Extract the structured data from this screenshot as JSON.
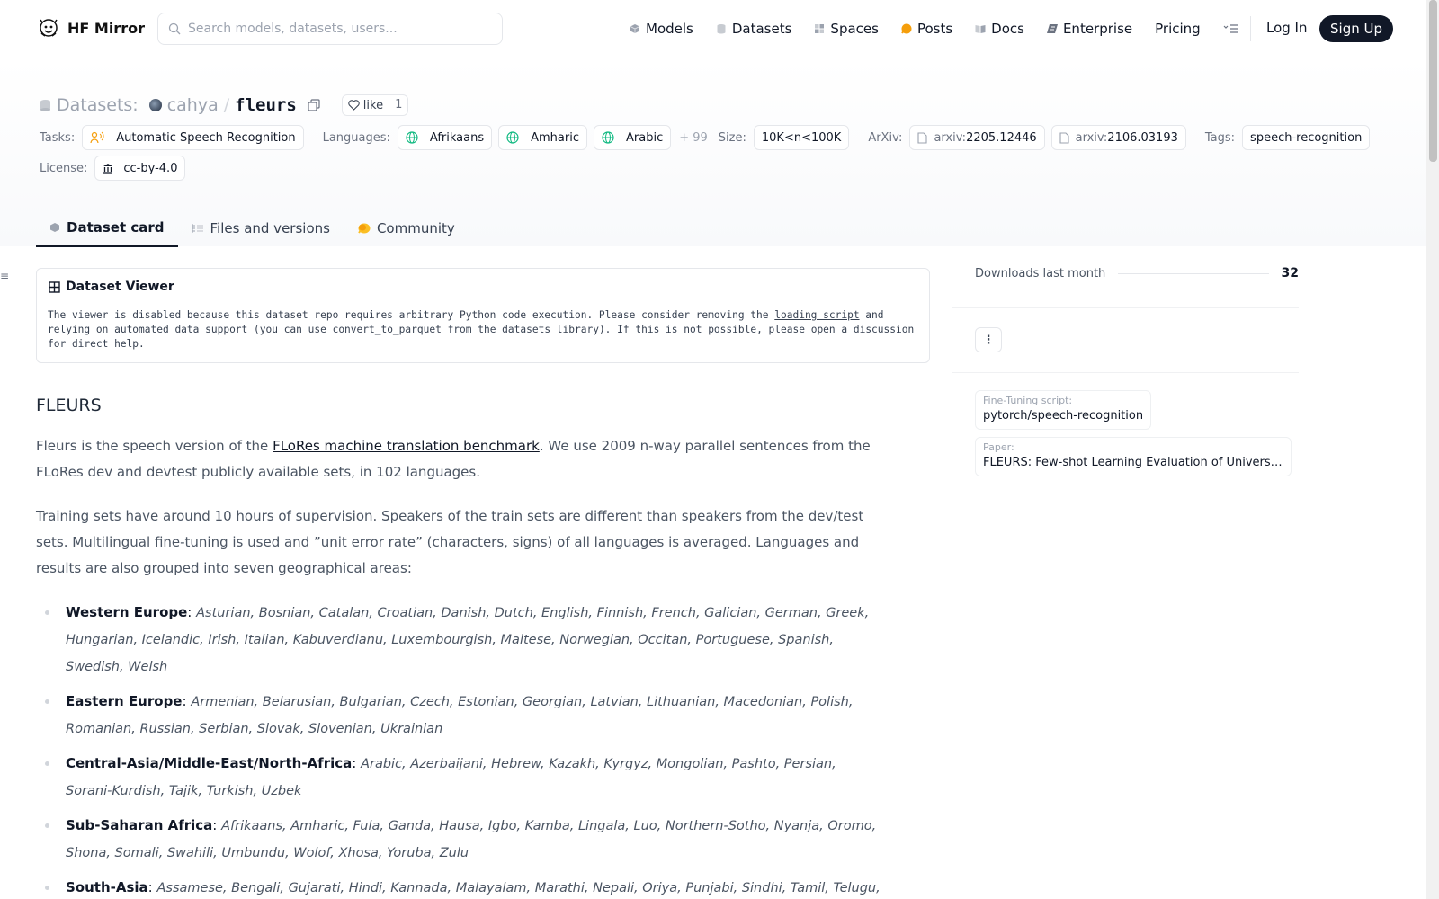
{
  "nav": {
    "brand": "HF Mirror",
    "search_placeholder": "Search models, datasets, users...",
    "links": [
      {
        "label": "Models",
        "icon": "models-icon",
        "color": "#6b7280"
      },
      {
        "label": "Datasets",
        "icon": "datasets-icon",
        "color": "#9ca3af"
      },
      {
        "label": "Spaces",
        "icon": "spaces-icon",
        "color": "#9ca3af"
      },
      {
        "label": "Posts",
        "icon": "posts-icon",
        "color": "#f59e0b"
      },
      {
        "label": "Docs",
        "icon": "docs-icon",
        "color": "#9ca3af"
      },
      {
        "label": "Enterprise",
        "icon": "enterprise-icon",
        "color": "#6b7280"
      },
      {
        "label": "Pricing",
        "icon": "",
        "color": ""
      }
    ],
    "login": "Log In",
    "signup": "Sign Up"
  },
  "header": {
    "section_label": "Datasets:",
    "owner": "cahya",
    "slash": "/",
    "repo": "fleurs",
    "like_label": "like",
    "like_count": "1",
    "tasks_label": "Tasks:",
    "task": "Automatic Speech Recognition",
    "languages_label": "Languages:",
    "languages": [
      "Afrikaans",
      "Amharic",
      "Arabic"
    ],
    "languages_more": "+ 99",
    "size_label": "Size:",
    "size": "10K<n<100K",
    "arxiv_label": "ArXiv:",
    "arxiv": [
      {
        "prefix": "arxiv:",
        "id": "2205.12446"
      },
      {
        "prefix": "arxiv:",
        "id": "2106.03193"
      }
    ],
    "tags_label": "Tags:",
    "tag": "speech-recognition",
    "license_label": "License:",
    "license": "cc-by-4.0"
  },
  "tabs": [
    {
      "label": "Dataset card",
      "active": true
    },
    {
      "label": "Files and versions",
      "active": false
    },
    {
      "label": "Community",
      "active": false
    }
  ],
  "viewer": {
    "title": "Dataset Viewer",
    "msg_1": "The viewer is disabled because this dataset repo requires arbitrary Python code execution. Please consider removing the ",
    "link_1": "loading script",
    "msg_2": " and relying on ",
    "link_2": "automated data support",
    "msg_3": " (you can use ",
    "link_3": "convert_to_parquet",
    "msg_4": " from the datasets library). If this is not possible, please ",
    "link_4": "open a discussion",
    "msg_5": " for direct help."
  },
  "article": {
    "title": "FLEURS",
    "p1_before": "Fleurs is the speech version of the ",
    "p1_link": "FLoRes machine translation benchmark",
    "p1_after": ". We use 2009 n-way parallel sentences from the FLoRes dev and devtest publicly available sets, in 102 languages.",
    "p2": "Training sets have around 10 hours of supervision. Speakers of the train sets are different than speakers from the dev/test sets. Multilingual fine-tuning is used and ”unit error rate” (characters, signs) of all languages is averaged. Languages and results are also grouped into seven geographical areas:",
    "regions": [
      {
        "name": "Western Europe",
        "langs": "Asturian, Bosnian, Catalan, Croatian, Danish, Dutch, English, Finnish, French, Galician, German, Greek, Hungarian, Icelandic, Irish, Italian, Kabuverdianu, Luxembourgish, Maltese, Norwegian, Occitan, Portuguese, Spanish, Swedish, Welsh"
      },
      {
        "name": "Eastern Europe",
        "langs": "Armenian, Belarusian, Bulgarian, Czech, Estonian, Georgian, Latvian, Lithuanian, Macedonian, Polish, Romanian, Russian, Serbian, Slovak, Slovenian, Ukrainian"
      },
      {
        "name": "Central-Asia/Middle-East/North-Africa",
        "langs": "Arabic, Azerbaijani, Hebrew, Kazakh, Kyrgyz, Mongolian, Pashto, Persian, Sorani-Kurdish, Tajik, Turkish, Uzbek"
      },
      {
        "name": "Sub-Saharan Africa",
        "langs": "Afrikaans, Amharic, Fula, Ganda, Hausa, Igbo, Kamba, Lingala, Luo, Northern-Sotho, Nyanja, Oromo, Shona, Somali, Swahili, Umbundu, Wolof, Xhosa, Yoruba, Zulu"
      },
      {
        "name": "South-Asia",
        "langs": "Assamese, Bengali, Gujarati, Hindi, Kannada, Malayalam, Marathi, Nepali, Oriya, Punjabi, Sindhi, Tamil, Telugu, Urdu"
      }
    ]
  },
  "sidebar": {
    "downloads_label": "Downloads last month",
    "downloads_value": "32",
    "cards": [
      {
        "key": "Fine-Tuning script:",
        "value": "pytorch/speech-recognition"
      },
      {
        "key": "Paper:",
        "value": "FLEURS: Few-shot Learning Evaluation of Universal Re…"
      }
    ]
  }
}
